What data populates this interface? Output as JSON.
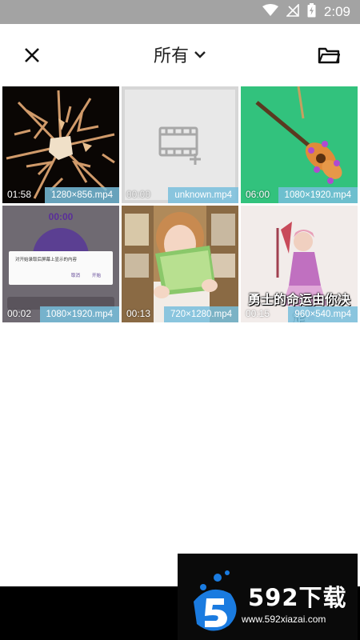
{
  "status_bar": {
    "time": "2:09"
  },
  "toolbar": {
    "album_title": "所有"
  },
  "videos": [
    {
      "duration": "01:58",
      "info": "1280×856.mp4"
    },
    {
      "duration": "00:00",
      "info": "unknown.mp4"
    },
    {
      "duration": "06:00",
      "info": "1080×1920.mp4"
    },
    {
      "duration": "00:02",
      "info": "1080×1920.mp4"
    },
    {
      "duration": "00:13",
      "info": "720×1280.mp4"
    },
    {
      "duration": "00:15",
      "info": "960×540.mp4"
    }
  ],
  "thumbnails": {
    "dialog_timer": "00:00",
    "dialog_text": "对开始录取后屏幕上显示的内容",
    "dialog_cancel": "取消",
    "dialog_start": "开始",
    "caption_text": "勇士的命运由你决定"
  },
  "watermark": {
    "brand": "592下载",
    "url": "www.592xiazai.com"
  },
  "colors": {
    "status_bar": "#a3a3a3",
    "meta_badge": "#78bedc",
    "accent": "#1a7be0"
  }
}
